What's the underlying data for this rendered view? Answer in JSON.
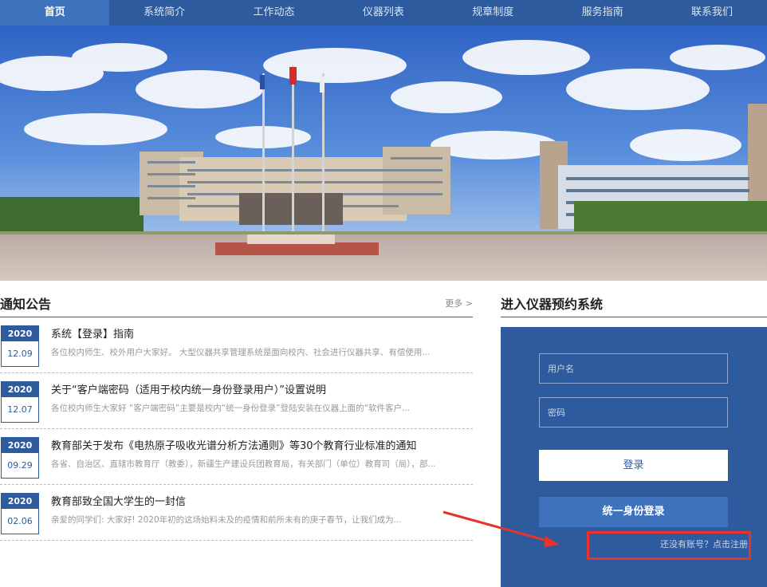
{
  "nav": {
    "items": [
      {
        "label": "首页",
        "active": true
      },
      {
        "label": "系统简介"
      },
      {
        "label": "工作动态"
      },
      {
        "label": "仪器列表"
      },
      {
        "label": "规章制度"
      },
      {
        "label": "服务指南"
      },
      {
        "label": "联系我们"
      }
    ]
  },
  "notices": {
    "title": "通知公告",
    "more": "更多 >",
    "items": [
      {
        "year": "2020",
        "md": "12.09",
        "title": "系统【登录】指南",
        "summary": "各位校内师生、校外用户大家好。       大型仪器共享管理系统是面向校内、社会进行仪器共享、有偿使用..."
      },
      {
        "year": "2020",
        "md": "12.07",
        "title": "关于“客户端密码（适用于校内统一身份登录用户）”设置说明",
        "summary": "各位校内师生大家好          “客户端密码”主要是校内“统一身份登录”登陆安装在仪器上面的“软件客户..."
      },
      {
        "year": "2020",
        "md": "09.29",
        "title": "教育部关于发布《电热原子吸收光谱分析方法通则》等30个教育行业标准的通知",
        "summary": " 各省、自治区、直辖市教育厅（教委），新疆生产建设兵团教育局，有关部门（单位）教育司（局），部..."
      },
      {
        "year": "2020",
        "md": "02.06",
        "title": "教育部致全国大学生的一封信",
        "summary": "亲爱的同学们:        大家好!        2020年初的这场始料未及的疫情和前所未有的庚子春节，让我们成为..."
      }
    ]
  },
  "login": {
    "heading": "进入仪器预约系统",
    "username_placeholder": "用户名",
    "password_placeholder": "密码",
    "login_button": "登录",
    "sso_button": "统一身份登录",
    "register_link": "还没有账号？点击注册"
  },
  "colors": {
    "primary": "#2d5b9e",
    "accent": "#3e72bd",
    "annotation": "#e8322c"
  }
}
